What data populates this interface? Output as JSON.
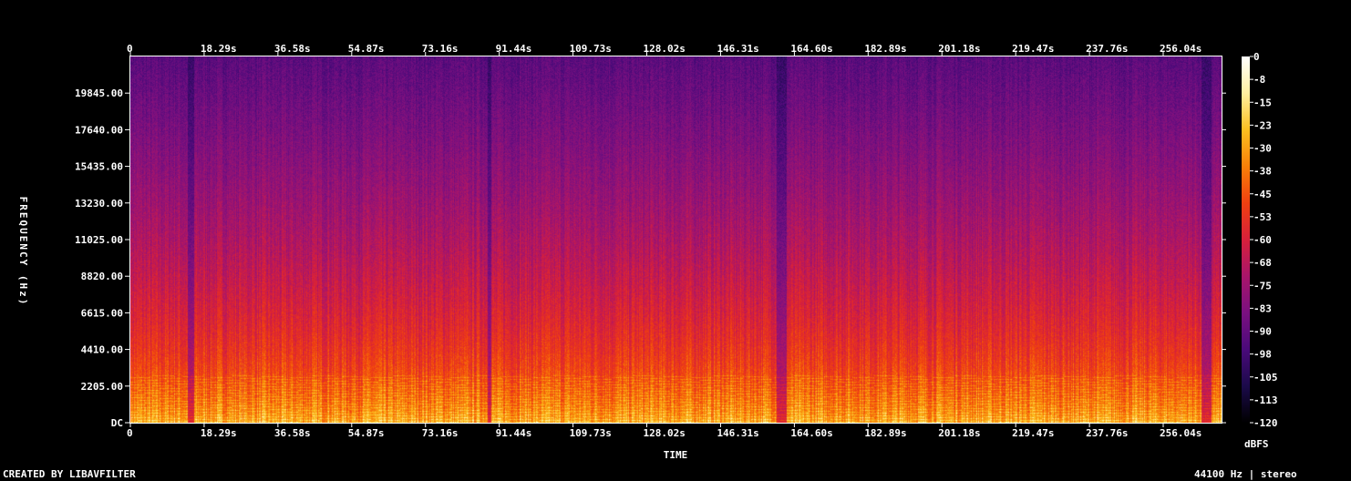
{
  "chart_data": {
    "type": "heatmap",
    "subtype": "spectrogram",
    "xlabel": "TIME",
    "ylabel": "FREQUENCY (Hz)",
    "x_ticks": [
      "0",
      "18.29s",
      "36.58s",
      "54.87s",
      "73.16s",
      "91.44s",
      "109.73s",
      "128.02s",
      "146.31s",
      "164.60s",
      "182.89s",
      "201.18s",
      "219.47s",
      "237.76s",
      "256.04s"
    ],
    "x_tick_values": [
      0,
      18.29,
      36.58,
      54.87,
      73.16,
      91.44,
      109.73,
      128.02,
      146.31,
      164.6,
      182.89,
      201.18,
      219.47,
      237.76,
      256.04
    ],
    "xlim": [
      0,
      270.5
    ],
    "y_ticks": [
      "DC",
      "2205.00",
      "4410.00",
      "6615.00",
      "8820.00",
      "11025.00",
      "13230.00",
      "15435.00",
      "17640.00",
      "19845.00"
    ],
    "y_tick_values": [
      0,
      2205,
      4410,
      6615,
      8820,
      11025,
      13230,
      15435,
      17640,
      19845
    ],
    "ylim": [
      0,
      22050
    ],
    "colorbar": {
      "label": "dBFS",
      "ticks": [
        "0",
        "-8",
        "-15",
        "-23",
        "-30",
        "-38",
        "-45",
        "-53",
        "-60",
        "-68",
        "-75",
        "-83",
        "-90",
        "-98",
        "-105",
        "-113",
        "-120"
      ],
      "range": [
        -120,
        0
      ]
    },
    "colormap": [
      "#000000",
      "#1b0a4a",
      "#4a0a7a",
      "#7a1080",
      "#a8156a",
      "#d8203a",
      "#f04010",
      "#f88008",
      "#fcc020",
      "#fff0a0",
      "#ffffff"
    ],
    "quiet_gaps_s": [
      [
        14.2,
        15.6
      ],
      [
        88.5,
        89.4
      ],
      [
        160.2,
        162.5
      ],
      [
        265.4,
        268.0
      ]
    ]
  },
  "footer": {
    "credit": "CREATED BY LIBAVFILTER",
    "format": "44100 Hz | stereo"
  }
}
